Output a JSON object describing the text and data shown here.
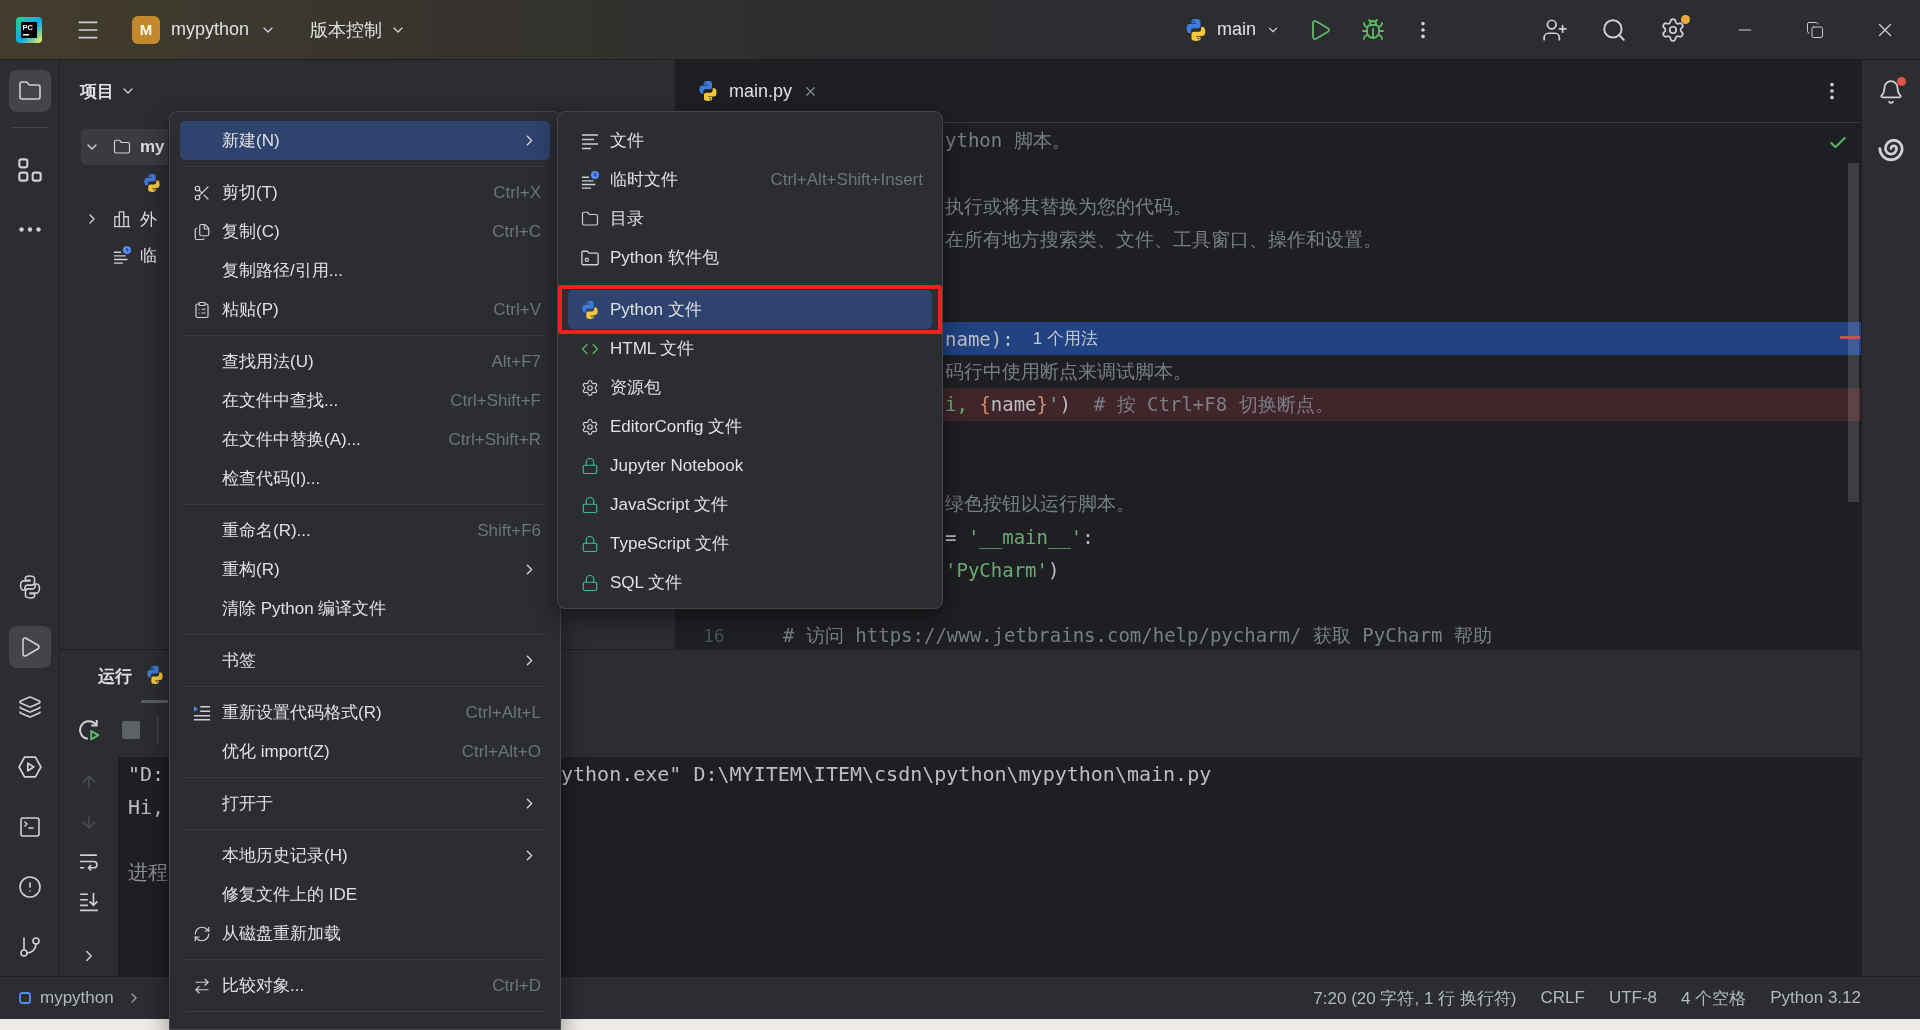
{
  "title_bar": {
    "logo": "PC",
    "project_badge": "M",
    "project": "mypython",
    "vcs": "版本控制",
    "run_config": "main",
    "settings_badge": true
  },
  "left_toolbar": {
    "top": [
      {
        "selected": true
      },
      {
        "selected": false
      },
      {
        "selected": false
      }
    ],
    "bottom": [
      {
        "selected": false
      },
      {
        "selected": true
      },
      {
        "selected": false
      },
      {
        "selected": false
      },
      {
        "selected": false
      },
      {
        "selected": false
      },
      {
        "selected": false
      }
    ]
  },
  "project_panel": {
    "title": "项目",
    "tree": [
      {
        "kind": "folder",
        "label": "my",
        "expanded": true,
        "selected": true,
        "children": [
          {
            "kind": "python",
            "selected": false
          }
        ]
      },
      {
        "kind": "library",
        "label": "外",
        "expanded": false,
        "selected": false
      },
      {
        "kind": "scratch",
        "label": "临",
        "selected": false
      }
    ]
  },
  "context_menu": {
    "items": [
      {
        "kind": "item",
        "label": "新建(N)",
        "submenu": true,
        "selected": true
      },
      {
        "kind": "separator"
      },
      {
        "kind": "item",
        "label": "剪切(T)",
        "shortcut": "Ctrl+X",
        "submenu": false,
        "selected": false
      },
      {
        "kind": "item",
        "label": "复制(C)",
        "shortcut": "Ctrl+C",
        "submenu": false,
        "selected": false
      },
      {
        "kind": "item",
        "label": "复制路径/引用...",
        "submenu": false,
        "selected": false
      },
      {
        "kind": "item",
        "label": "粘贴(P)",
        "shortcut": "Ctrl+V",
        "submenu": false,
        "selected": false
      },
      {
        "kind": "separator"
      },
      {
        "kind": "item",
        "label": "查找用法(U)",
        "shortcut": "Alt+F7",
        "submenu": false,
        "selected": false
      },
      {
        "kind": "item",
        "label": "在文件中查找...",
        "shortcut": "Ctrl+Shift+F",
        "submenu": false,
        "selected": false
      },
      {
        "kind": "item",
        "label": "在文件中替换(A)...",
        "shortcut": "Ctrl+Shift+R",
        "submenu": false,
        "selected": false
      },
      {
        "kind": "item",
        "label": "检查代码(I)...",
        "submenu": false,
        "selected": false
      },
      {
        "kind": "separator"
      },
      {
        "kind": "item",
        "label": "重命名(R)...",
        "shortcut": "Shift+F6",
        "submenu": false,
        "selected": false
      },
      {
        "kind": "item",
        "label": "重构(R)",
        "submenu": true,
        "selected": false
      },
      {
        "kind": "item",
        "label": "清除 Python 编译文件",
        "submenu": false,
        "selected": false
      },
      {
        "kind": "separator"
      },
      {
        "kind": "item",
        "label": "书签",
        "submenu": true,
        "selected": false
      },
      {
        "kind": "separator"
      },
      {
        "kind": "item",
        "label": "重新设置代码格式(R)",
        "shortcut": "Ctrl+Alt+L",
        "submenu": false,
        "selected": false
      },
      {
        "kind": "item",
        "label": "优化 import(Z)",
        "shortcut": "Ctrl+Alt+O",
        "submenu": false,
        "selected": false
      },
      {
        "kind": "separator"
      },
      {
        "kind": "item",
        "label": "打开于",
        "submenu": true,
        "selected": false
      },
      {
        "kind": "separator"
      },
      {
        "kind": "item",
        "label": "本地历史记录(H)",
        "submenu": true,
        "selected": false
      },
      {
        "kind": "item",
        "label": "修复文件上的 IDE",
        "submenu": false,
        "selected": false
      },
      {
        "kind": "item",
        "label": "从磁盘重新加载",
        "submenu": false,
        "selected": false
      },
      {
        "kind": "separator"
      },
      {
        "kind": "item",
        "label": "比较对象...",
        "shortcut": "Ctrl+D",
        "submenu": false,
        "selected": false
      },
      {
        "kind": "separator"
      }
    ]
  },
  "new_submenu": {
    "items": [
      {
        "kind": "item",
        "label": "文件",
        "selected": false,
        "annotated": false
      },
      {
        "kind": "item",
        "label": "临时文件",
        "shortcut": "Ctrl+Alt+Shift+Insert",
        "selected": false,
        "annotated": false
      },
      {
        "kind": "item",
        "label": "目录",
        "selected": false,
        "annotated": false
      },
      {
        "kind": "item",
        "label": "Python 软件包",
        "selected": false,
        "annotated": false
      },
      {
        "kind": "separator"
      },
      {
        "kind": "item",
        "label": "Python 文件",
        "selected": true,
        "annotated": true
      },
      {
        "kind": "item",
        "label": "HTML 文件",
        "selected": false,
        "annotated": false
      },
      {
        "kind": "item",
        "label": "资源包",
        "selected": false,
        "annotated": false
      },
      {
        "kind": "item",
        "label": "EditorConfig 文件",
        "selected": false,
        "annotated": false
      },
      {
        "kind": "item",
        "label": "Jupyter Notebook",
        "selected": false,
        "annotated": false
      },
      {
        "kind": "item",
        "label": "JavaScript 文件",
        "selected": false,
        "annotated": false
      },
      {
        "kind": "item",
        "label": "TypeScript 文件",
        "selected": false,
        "annotated": false
      },
      {
        "kind": "item",
        "label": "SQL 文件",
        "selected": false,
        "annotated": false
      }
    ]
  },
  "editor": {
    "tab": {
      "label": "main.py"
    },
    "lines": [
      {
        "kind": "code",
        "highlighted": false,
        "breakpoint": false,
        "tokens": [
          {
            "text": "ython 脚本。",
            "kind": "comment"
          }
        ]
      },
      {
        "kind": "blank"
      },
      {
        "kind": "code",
        "highlighted": false,
        "breakpoint": false,
        "tokens": [
          {
            "text": "执行或将其替换为您的代码。",
            "kind": "comment"
          }
        ]
      },
      {
        "kind": "code",
        "highlighted": false,
        "breakpoint": false,
        "tokens": [
          {
            "text": "在所有地方搜索类、文件、工具窗口、操作和设置。",
            "kind": "comment"
          }
        ]
      },
      {
        "kind": "blank"
      },
      {
        "kind": "blank"
      },
      {
        "kind": "code",
        "highlighted": true,
        "breakpoint": false,
        "tokens": [
          {
            "text": "name):",
            "kind": "plain"
          }
        ],
        "hint": "1 个用法"
      },
      {
        "kind": "code",
        "highlighted": false,
        "breakpoint": false,
        "tokens": [
          {
            "text": "码行中使用断点来调试脚本。",
            "kind": "comment"
          }
        ]
      },
      {
        "kind": "code",
        "highlighted": false,
        "breakpoint": true,
        "tokens": [
          {
            "text": "i, ",
            "kind": "string"
          },
          {
            "text": "{",
            "kind": "brace"
          },
          {
            "text": "name",
            "kind": "plain"
          },
          {
            "text": "}",
            "kind": "brace"
          },
          {
            "text": "'",
            "kind": "string"
          },
          {
            "text": ")",
            "kind": "plain"
          },
          {
            "text": "  # 按 Ctrl+F8 切换断点。",
            "kind": "comment"
          }
        ]
      },
      {
        "kind": "blank"
      },
      {
        "kind": "blank"
      },
      {
        "kind": "code",
        "highlighted": false,
        "breakpoint": false,
        "tokens": [
          {
            "text": "绿色按钮以运行脚本。",
            "kind": "comment"
          }
        ]
      },
      {
        "kind": "code",
        "highlighted": false,
        "breakpoint": false,
        "tokens": [
          {
            "text": "= ",
            "kind": "plain"
          },
          {
            "text": "'__main__'",
            "kind": "string"
          },
          {
            "text": ":",
            "kind": "plain"
          }
        ]
      },
      {
        "kind": "code",
        "highlighted": false,
        "breakpoint": false,
        "tokens": [
          {
            "text": "'PyCharm'",
            "kind": "string"
          },
          {
            "text": ")",
            "kind": "plain"
          }
        ]
      },
      {
        "kind": "blank"
      },
      {
        "kind": "code",
        "highlighted": false,
        "breakpoint": false,
        "number": "16",
        "tokens": [
          {
            "text": "# 访问 https://www.jetbrains.com/help/pycharm/ 获取 PyCharm 帮助",
            "kind": "comment"
          }
        ]
      }
    ]
  },
  "right_toolbar": {
    "notification_badge": true
  },
  "run_panel": {
    "title": "运行",
    "tabs": [
      {
        "selected": true
      }
    ],
    "console": [
      {
        "kind": "output",
        "text": "\"D:",
        "continuation": "ython.exe\" D:\\MYITEM\\ITEM\\csdn\\python\\mypython\\main.py"
      },
      {
        "kind": "output",
        "text": "Hi,"
      },
      {
        "kind": "blank"
      },
      {
        "kind": "system",
        "text": "进程"
      }
    ]
  },
  "status_bar": {
    "breadcrumb": [
      {
        "label": "mypython"
      }
    ],
    "items": [
      "7:20 (20 字符, 1 行 换行符)",
      "CRLF",
      "UTF-8",
      "4 个空格",
      "Python 3.12"
    ]
  }
}
